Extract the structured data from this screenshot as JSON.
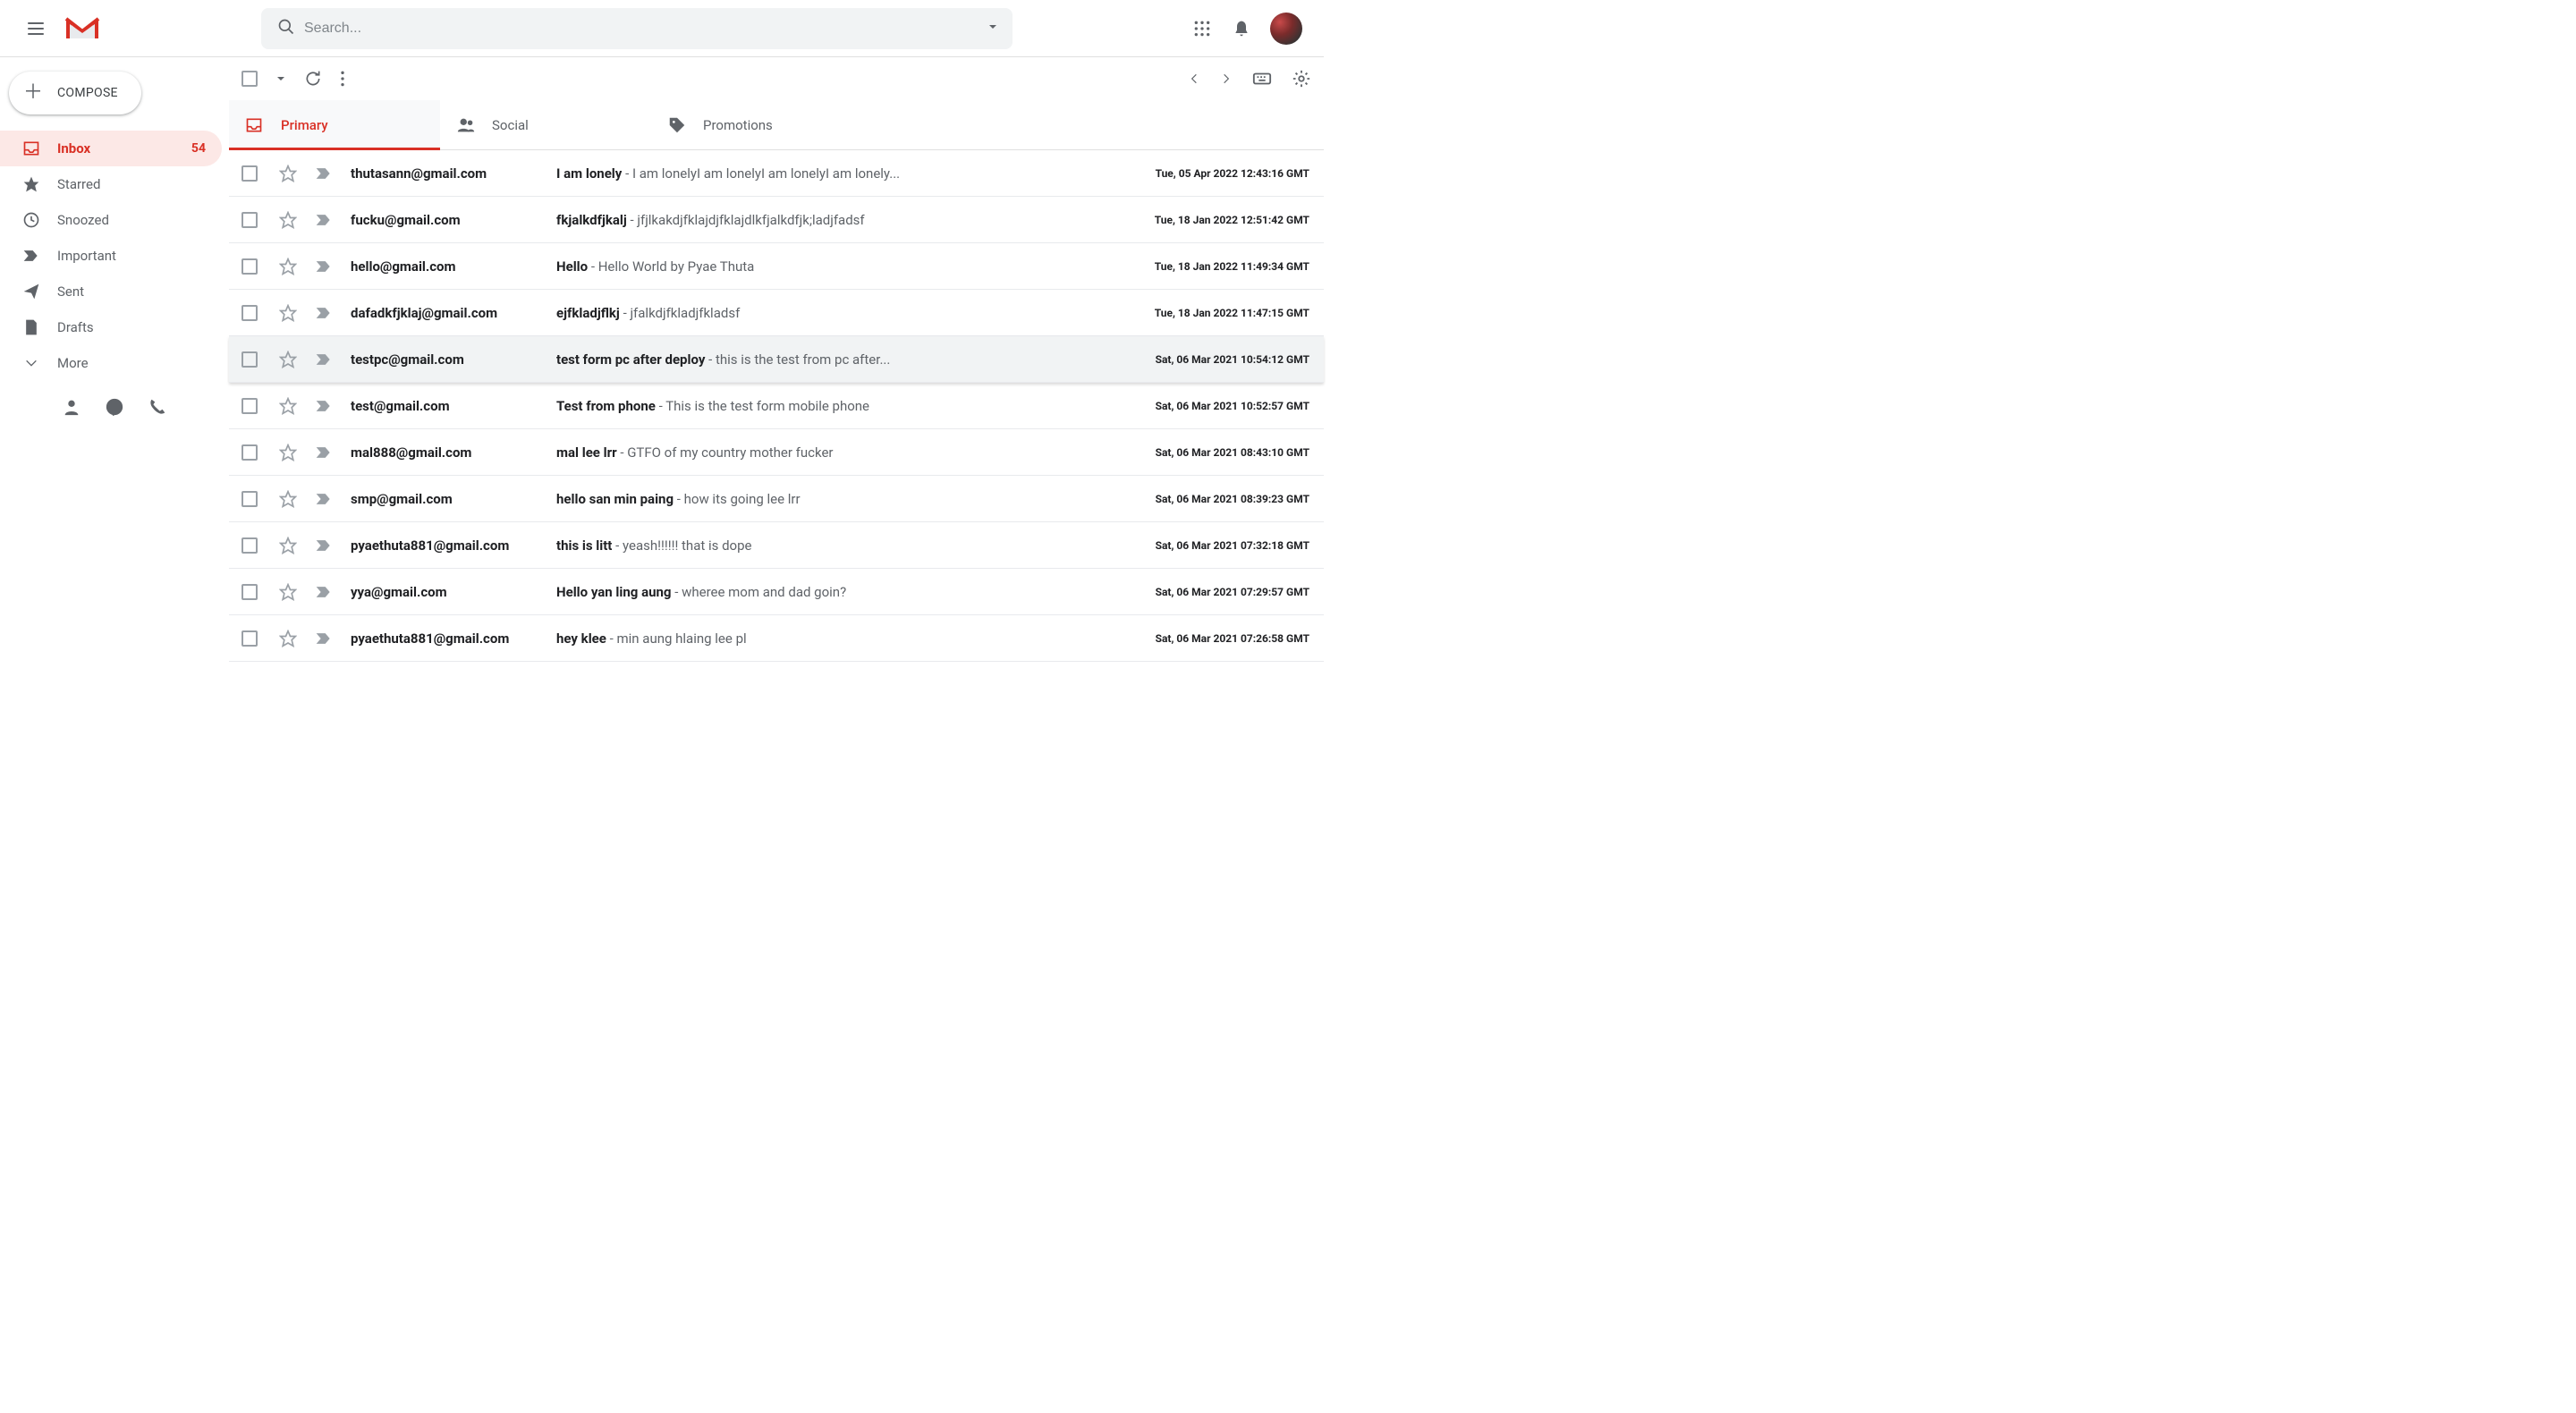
{
  "header": {
    "search_placeholder": "Search..."
  },
  "sidebar": {
    "compose_label": "COMPOSE",
    "items": [
      {
        "label": "Inbox",
        "count": "54"
      },
      {
        "label": "Starred"
      },
      {
        "label": "Snoozed"
      },
      {
        "label": "Important"
      },
      {
        "label": "Sent"
      },
      {
        "label": "Drafts"
      },
      {
        "label": "More"
      }
    ]
  },
  "tabs": [
    {
      "label": "Primary"
    },
    {
      "label": "Social"
    },
    {
      "label": "Promotions"
    }
  ],
  "emails": [
    {
      "sender": "thutasann@gmail.com",
      "subject": "I am lonely",
      "snippet": "I am lonelyI am lonelyI am lonelyI am lonely...",
      "date": "Tue, 05 Apr 2022 12:43:16 GMT"
    },
    {
      "sender": "fucku@gmail.com",
      "subject": "fkjalkdfjkalj",
      "snippet": "jfjlkakdjfklajdjfklajdlkfjalkdfjk;ladjfadsf",
      "date": "Tue, 18 Jan 2022 12:51:42 GMT"
    },
    {
      "sender": "hello@gmail.com",
      "subject": "Hello",
      "snippet": "Hello World by Pyae Thuta",
      "date": "Tue, 18 Jan 2022 11:49:34 GMT"
    },
    {
      "sender": "dafadkfjklaj@gmail.com",
      "subject": "ejfkladjflkj",
      "snippet": "jfalkdjfkladjfkladsf",
      "date": "Tue, 18 Jan 2022 11:47:15 GMT"
    },
    {
      "sender": "testpc@gmail.com",
      "subject": "test form pc after deploy",
      "snippet": "this is the test from pc after...",
      "date": "Sat, 06 Mar 2021 10:54:12 GMT",
      "highlight": true
    },
    {
      "sender": "test@gmail.com",
      "subject": "Test from phone",
      "snippet": "This is the test form mobile phone",
      "date": "Sat, 06 Mar 2021 10:52:57 GMT"
    },
    {
      "sender": "mal888@gmail.com",
      "subject": "mal lee lrr",
      "snippet": "GTFO of my country mother fucker",
      "date": "Sat, 06 Mar 2021 08:43:10 GMT"
    },
    {
      "sender": "smp@gmail.com",
      "subject": "hello san min paing",
      "snippet": "how its going lee lrr",
      "date": "Sat, 06 Mar 2021 08:39:23 GMT"
    },
    {
      "sender": "pyaethuta881@gmail.com",
      "subject": "this is litt",
      "snippet": "yeash!!!!!! that is dope",
      "date": "Sat, 06 Mar 2021 07:32:18 GMT"
    },
    {
      "sender": "yya@gmail.com",
      "subject": "Hello yan ling aung",
      "snippet": "wheree mom and dad goin?",
      "date": "Sat, 06 Mar 2021 07:29:57 GMT"
    },
    {
      "sender": "pyaethuta881@gmail.com",
      "subject": "hey klee",
      "snippet": "min aung hlaing lee pl",
      "date": "Sat, 06 Mar 2021 07:26:58 GMT"
    }
  ]
}
